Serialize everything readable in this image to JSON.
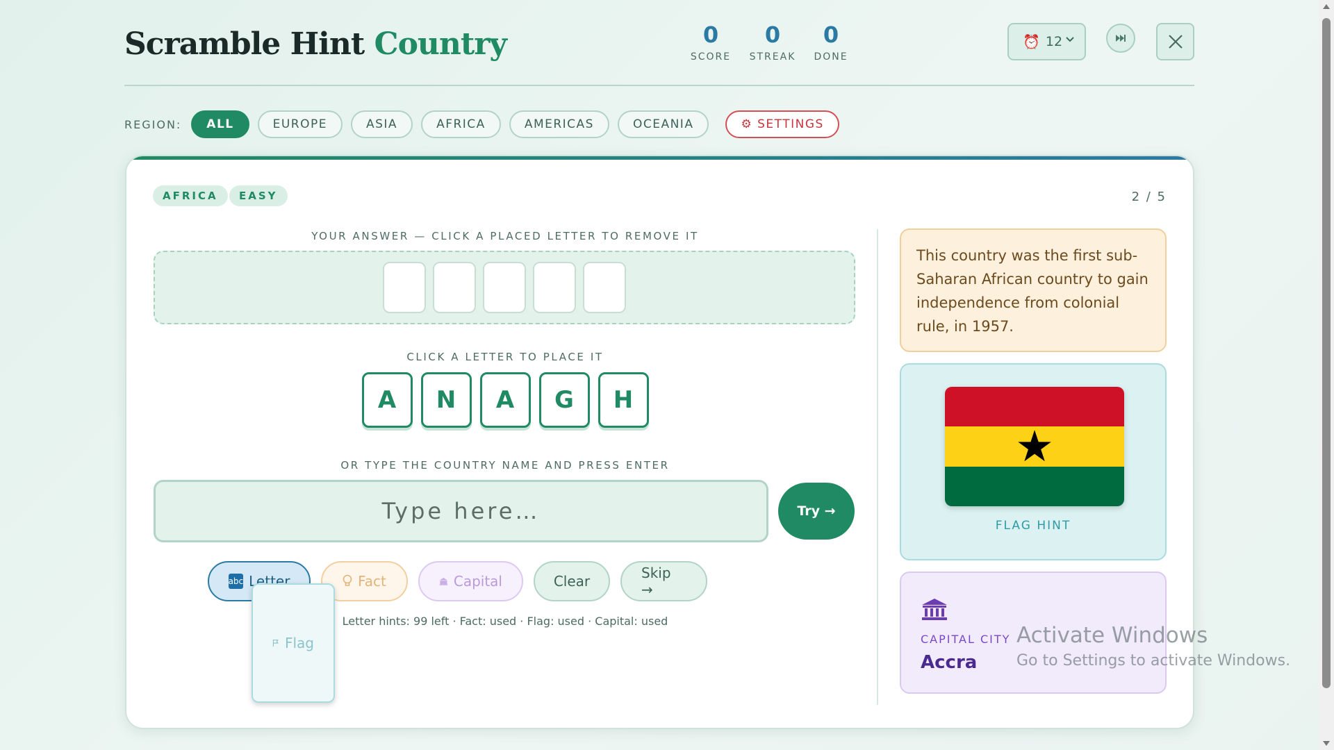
{
  "header": {
    "title_main": "Scramble Hint",
    "title_accent": "Country",
    "stats": [
      {
        "value": "0",
        "label": "SCORE"
      },
      {
        "value": "0",
        "label": "STREAK"
      },
      {
        "value": "0",
        "label": "DONE"
      }
    ],
    "timer_value": "12",
    "timer_icon": "alarm-clock-icon",
    "ffwd_icon": "fast-forward-icon",
    "close_icon": "close-icon"
  },
  "region": {
    "label": "REGION:",
    "options": [
      "ALL",
      "EUROPE",
      "ASIA",
      "AFRICA",
      "AMERICAS",
      "OCEANIA"
    ],
    "selected": "ALL",
    "settings_label": "⚙ SETTINGS"
  },
  "card": {
    "tags": [
      "AFRICA",
      "EASY"
    ],
    "progress": "2 / 5",
    "answer_label": "YOUR ANSWER — CLICK A PLACED LETTER TO REMOVE IT",
    "slots_count": 5,
    "tiles_label": "CLICK A LETTER TO PLACE IT",
    "tiles": [
      "A",
      "N",
      "A",
      "G",
      "H"
    ],
    "type_label": "OR TYPE THE COUNTRY NAME AND PRESS ENTER",
    "type_placeholder": "Type here…",
    "try_label": "Try →",
    "hint_buttons": {
      "letter": "Letter",
      "fact": "Fact",
      "flag": "Flag",
      "capital": "Capital",
      "clear": "Clear",
      "skip": "Skip →"
    },
    "hint_status": "Letter hints: 99 left · Fact: used · Flag: used · Capital: used",
    "fact_text": "This country was the first sub-Saharan African country to gain independence from colonial rule, in 1957.",
    "flag": {
      "label": "FLAG HINT",
      "colors": [
        "#CE1126",
        "#FCD116",
        "#006B3F"
      ],
      "star_color": "#000000"
    },
    "capital": {
      "label": "CAPITAL CITY",
      "name": "Accra",
      "icon": "classical-building-icon"
    }
  },
  "watermark": {
    "line1": "Activate Windows",
    "line2": "Go to Settings to activate Windows."
  },
  "colors": {
    "brand_green": "#1f8a63",
    "accent_blue": "#2a7aa3",
    "settings_red": "#c8363d"
  }
}
